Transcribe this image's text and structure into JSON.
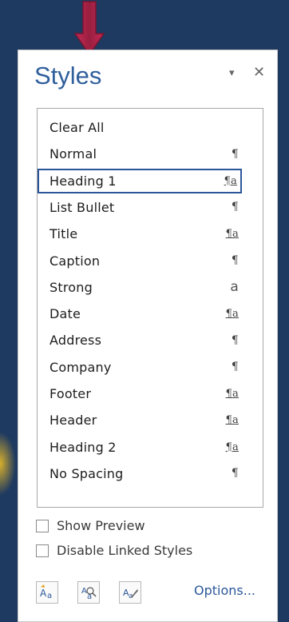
{
  "pane": {
    "title": "Styles",
    "dropdown_glyph": "▾",
    "close_glyph": "✕"
  },
  "styles": [
    {
      "label": "Clear All",
      "marker": "",
      "type": "none"
    },
    {
      "label": "Normal",
      "marker": "¶",
      "type": "paragraph"
    },
    {
      "label": "Heading 1",
      "marker": "¶a",
      "type": "linked",
      "selected": true
    },
    {
      "label": "List Bullet",
      "marker": "¶",
      "type": "paragraph"
    },
    {
      "label": "Title",
      "marker": "¶a",
      "type": "linked"
    },
    {
      "label": "Caption",
      "marker": "¶",
      "type": "paragraph"
    },
    {
      "label": "Strong",
      "marker": "a",
      "type": "character"
    },
    {
      "label": "Date",
      "marker": "¶a",
      "type": "linked"
    },
    {
      "label": "Address",
      "marker": "¶",
      "type": "paragraph"
    },
    {
      "label": "Company",
      "marker": "¶",
      "type": "paragraph"
    },
    {
      "label": "Footer",
      "marker": "¶a",
      "type": "linked"
    },
    {
      "label": "Header",
      "marker": "¶a",
      "type": "linked"
    },
    {
      "label": "Heading 2",
      "marker": "¶a",
      "type": "linked"
    },
    {
      "label": "No Spacing",
      "marker": "¶",
      "type": "paragraph"
    }
  ],
  "options": {
    "show_preview": "Show Preview",
    "disable_linked_styles": "Disable Linked Styles"
  },
  "toolbar": {
    "new_style_icon": "new-style-icon",
    "style_inspector_icon": "style-inspector-icon",
    "manage_styles_icon": "manage-styles-icon",
    "options_label": "Options..."
  },
  "colors": {
    "title": "#2f5f9c",
    "selection_border": "#2b579a",
    "arrow": "#b5224b"
  }
}
